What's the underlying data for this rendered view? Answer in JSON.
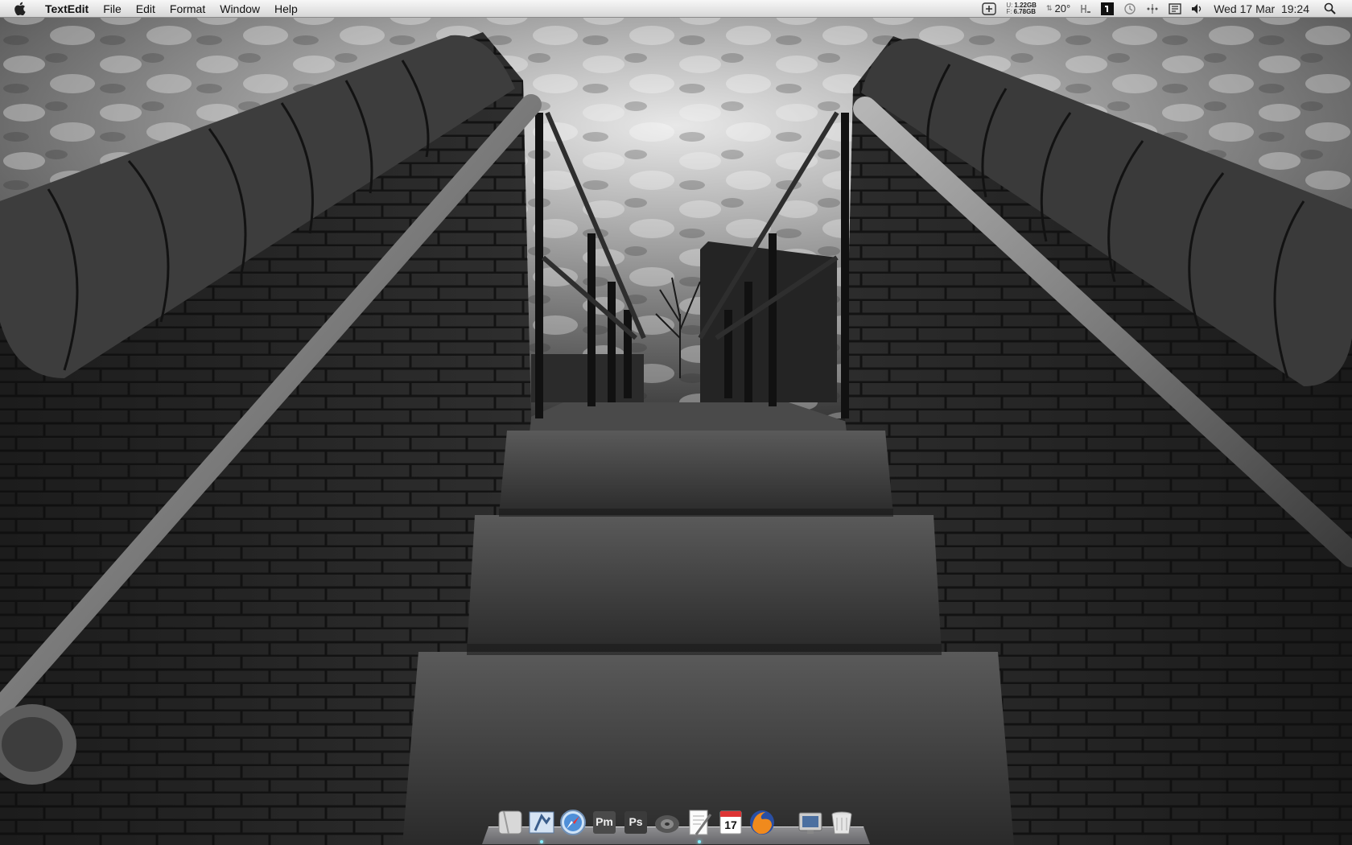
{
  "menubar": {
    "app_name": "TextEdit",
    "menus": [
      "File",
      "Edit",
      "Format",
      "Window",
      "Help"
    ],
    "disk_used_label": "U:",
    "disk_used_value": "1.22GB",
    "disk_free_label": "F:",
    "disk_free_value": "6.78GB",
    "temperature": "20°",
    "clock": "Wed 17 Mar  19:24"
  },
  "dock": {
    "apps": [
      "finder",
      "mail",
      "safari",
      "pagemaker",
      "photoshop",
      "speaker",
      "textedit",
      "ical",
      "firefox",
      "system-preferences",
      "trash"
    ],
    "pm_label": "Pm",
    "ps_label": "Ps",
    "ical_day": "17"
  },
  "colors": {
    "menubar_top": "#f7f7f7",
    "menubar_bottom": "#d6d6d6",
    "photoshop_blue": "#1f3a6b",
    "firefox_orange": "#f08a1d"
  }
}
